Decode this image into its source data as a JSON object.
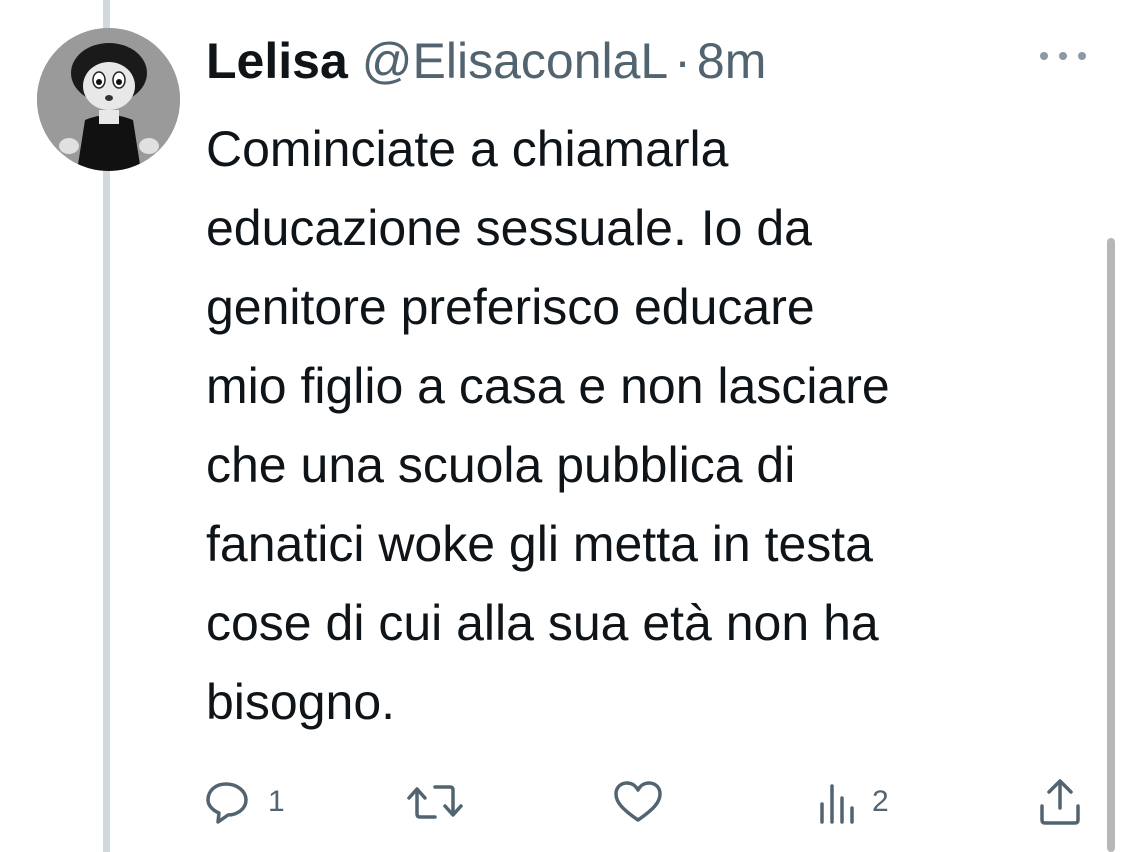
{
  "tweet": {
    "display_name": "Lelisa",
    "handle": "@ElisaconlaL",
    "separator": "·",
    "time": "8m",
    "text": "Cominciate a chiamarla\neducazione sessuale. Io da\ngenitore preferisco educare\nmio figlio a casa e non lasciare\nche una scuola pubblica di\nfanatici woke gli metta in testa\ncose di cui alla sua età non ha\nbisogno."
  },
  "actions": {
    "reply_count": "1",
    "retweet_count": "",
    "like_count": "",
    "views_count": "2"
  },
  "icons": {
    "avatar": "cartoon-character-avatar",
    "more": "more-horizontal-icon",
    "reply": "reply-bubble-icon",
    "retweet": "retweet-icon",
    "like": "heart-icon",
    "views": "bar-chart-icon",
    "share": "share-upload-icon"
  },
  "colors": {
    "text": "#0f1419",
    "secondary": "#536471",
    "thread_line": "#cfd9de"
  }
}
